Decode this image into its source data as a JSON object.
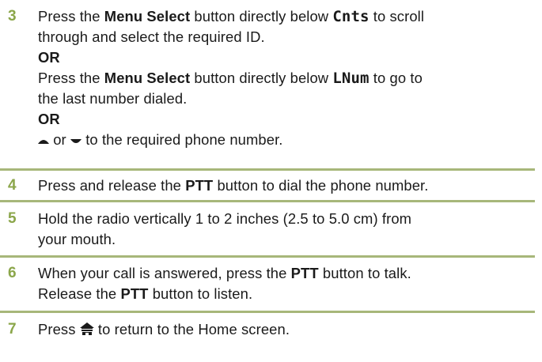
{
  "steps": [
    {
      "number": "3",
      "line1_pre": "Press the ",
      "line1_bold": "Menu Select",
      "line1_mid": " button directly below ",
      "line1_key": "Cnts",
      "line1_post": " to scroll",
      "line2": "through and select the required ID.",
      "or1": "OR",
      "line3_pre": "Press the ",
      "line3_bold": "Menu Select",
      "line3_mid": " button directly below ",
      "line3_key": "LNum",
      "line3_post": " to go to",
      "line4": "the last number dialed.",
      "or2": "OR",
      "line5_mid": " or ",
      "line5_post": " to the required phone number."
    },
    {
      "number": "4",
      "pre": "Press and release the ",
      "bold": "PTT",
      "post": " button to dial the phone number."
    },
    {
      "number": "5",
      "line1": "Hold the radio vertically 1 to 2 inches (2.5 to 5.0 cm) from",
      "line2": "your mouth."
    },
    {
      "number": "6",
      "l1_pre": "When your call is answered, press the ",
      "l1_bold": "PTT",
      "l1_post": " button to talk.",
      "l2_pre": "Release the ",
      "l2_bold": "PTT",
      "l2_post": " button to listen."
    },
    {
      "number": "7",
      "pre": "Press ",
      "post": " to return to the Home screen."
    }
  ],
  "icons": {
    "up_arrow": "up-arrow-icon",
    "down_arrow": "down-arrow-icon",
    "home": "home-icon"
  },
  "colors": {
    "step_number": "#8ba64a",
    "divider": "#a7b77a",
    "text": "#1a1a1a"
  }
}
